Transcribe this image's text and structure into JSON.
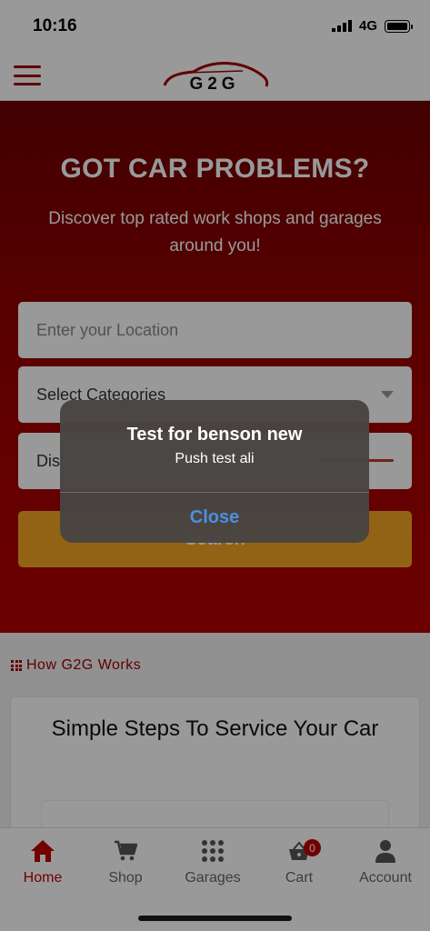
{
  "status_bar": {
    "time": "10:16",
    "network": "4G"
  },
  "header": {
    "logo_text": "G2G"
  },
  "hero": {
    "title": "GOT CAR PROBLEMS?",
    "subtitle": "Discover top rated work shops and garages around you!",
    "location_placeholder": "Enter your Location",
    "category_label": "Select Categories",
    "distance_label": "Dist",
    "search_label": "Search"
  },
  "how_it_works": {
    "heading": "How G2G Works",
    "card_title": "Simple Steps To Service Your Car"
  },
  "tabbar": {
    "items": [
      {
        "label": "Home",
        "icon": "home-icon",
        "active": true
      },
      {
        "label": "Shop",
        "icon": "cart-icon",
        "active": false
      },
      {
        "label": "Garages",
        "icon": "grid-icon",
        "active": false
      },
      {
        "label": "Cart",
        "icon": "basket-icon",
        "active": false
      },
      {
        "label": "Account",
        "icon": "user-icon",
        "active": false
      }
    ],
    "cart_count": "0"
  },
  "alert": {
    "title": "Test for benson new",
    "message": "Push test ali",
    "close_label": "Close"
  },
  "colors": {
    "brand": "#a00000",
    "accent": "#f5a623",
    "link": "#4a90e2"
  }
}
